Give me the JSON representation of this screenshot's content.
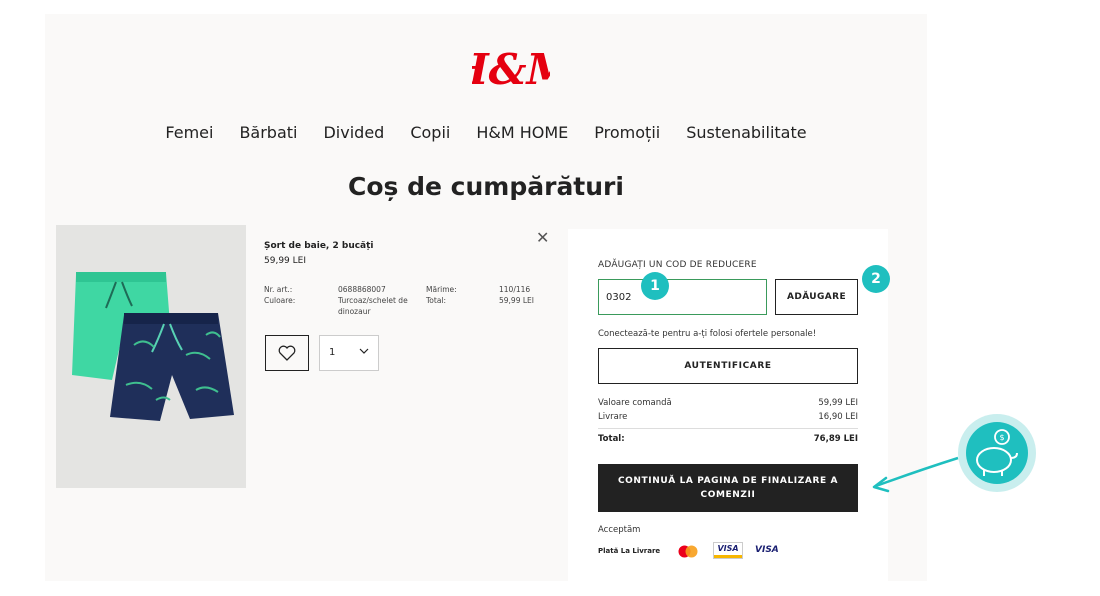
{
  "brand": {
    "logo_text": "H&M",
    "color": "#e50010"
  },
  "nav": {
    "items": [
      "Femei",
      "Bărbati",
      "Divided",
      "Copii",
      "H&M HOME",
      "Promoții",
      "Sustenabilitate"
    ]
  },
  "page_title": "Coș de cumpărături",
  "product": {
    "name": "Șort de baie, 2 bucăți",
    "price": "59,99 LEI",
    "art_label": "Nr. art.:",
    "art_value": "0688868007",
    "color_label": "Culoare:",
    "color_value": "Turcoaz/schelet de dinozaur",
    "size_label": "Mărime:",
    "size_value": "110/116",
    "total_label": "Total:",
    "total_value": "59,99 LEI",
    "quantity": "1",
    "icons": {
      "close": "close-icon",
      "favorite": "heart-icon",
      "quantity": "chevron-down-icon"
    }
  },
  "summary": {
    "discount_label": "ADĂUGAȚI UN COD DE REDUCERE",
    "discount_value": "0302",
    "add_button": "ADĂUGARE",
    "login_message": "Conectează-te pentru a-ți folosi ofertele personale!",
    "auth_button": "AUTENTIFICARE",
    "order_value_label": "Valoare comandă",
    "order_value": "59,99 LEI",
    "delivery_label": "Livrare",
    "delivery_value": "16,90 LEI",
    "total_label": "Total:",
    "total_value": "76,89 LEI",
    "checkout_button": "CONTINUĂ LA PAGINA DE FINALIZARE A COMENZII",
    "accept_label": "Acceptăm",
    "payment_cod": "Plată La Livrare",
    "payment_visa_1": "VISA",
    "payment_visa_2": "VISA"
  },
  "annotations": {
    "badge_1": "1",
    "badge_2": "2",
    "accent_color": "#1fbfbf",
    "icon": "piggy-bank-icon"
  }
}
